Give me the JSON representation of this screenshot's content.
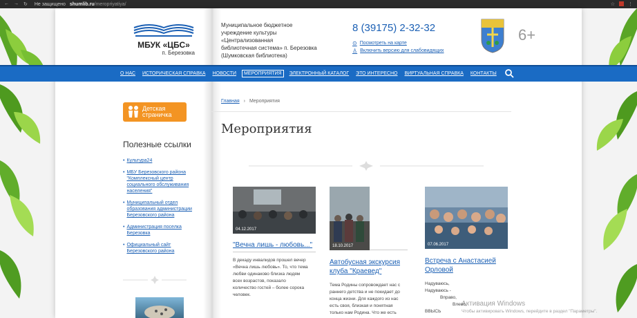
{
  "browser": {
    "insecure_label": "Не защищено",
    "url_host": "shumlib.ru",
    "url_path": "/meropriyatiya/"
  },
  "header": {
    "logo_title": "МБУК «ЦБС»",
    "logo_subtitle": "п. Березовка",
    "org_lines": [
      "Муниципальное бюджетное",
      "учреждение культуры",
      "«Централизованная",
      "библиотечная система» п. Березовка",
      "(Шумковская библиотека)"
    ],
    "phone": "8 (39175) 2-32-32",
    "map_link": "Посмотреть на карте",
    "accessibility_link": "Включить версию для слабовидящих",
    "age_rating": "6+"
  },
  "nav": {
    "items": [
      "О НАС",
      "ИСТОРИЧЕСКАЯ СПРАВКА",
      "НОВОСТИ",
      "МЕРОПРИЯТИЯ",
      "ЭЛЕКТРОННЫЙ КАТАЛОГ",
      "ЭТО ИНТЕРЕСНО",
      "ВИРТУАЛЬНАЯ СПРАВКА",
      "КОНТАКТЫ"
    ],
    "active": "МЕРОПРИЯТИЯ"
  },
  "sidebar": {
    "kids_button": [
      "Детская",
      "страничка"
    ],
    "links_title": "Полезные ссылки",
    "links": [
      [
        "Культура24"
      ],
      [
        "МБУ Березовского района",
        "\"Комплексный центр",
        "социального обслуживания",
        "населения\""
      ],
      [
        "Муниципальный отдел",
        "образования администрации",
        "Березовского района"
      ],
      [
        "Администрация поселка",
        "Березовка"
      ],
      [
        "Официальный сайт",
        "Березовского района"
      ]
    ]
  },
  "main": {
    "breadcrumb_home": "Главная",
    "breadcrumb_sep": "›",
    "breadcrumb_current": "Мероприятия",
    "title": "Мероприятия",
    "cards": [
      {
        "date": "04.12.2017",
        "title_lines": [
          "\"Вечна лишь - любовь...\""
        ],
        "text_lines": [
          "В декаду инвалидов прошел вечер",
          "«Вечна лишь любовь». То, что тема",
          "любви одинаково близка людям",
          "всех возрастов, показало",
          "количество гостей – более сорока",
          "человек."
        ]
      },
      {
        "date": "18.10.2017",
        "title_lines": [
          "Автобусная экскурсия",
          "клуба \"Краевед\""
        ],
        "text_lines": [
          "Тема Родины сопровождает нас с",
          "раннего детства и не покидает до",
          "конца жизни. Для каждого из нас",
          "есть своя, близкая и понятная",
          "только нам Родина. Что же есть"
        ]
      },
      {
        "date": "07.06.2017",
        "title_lines": [
          "Встреча с Анастасией",
          "Орловой"
        ],
        "text_lines": [
          "Надуваюсь,",
          "Надуваюсь -",
          "Вправо,",
          "Влево,",
          "ВВЫСЬ"
        ]
      }
    ]
  },
  "watermark": {
    "line1": "Активация Windows",
    "line2": "Чтобы активировать Windows, перейдите в раздел \"Параметры\"."
  }
}
